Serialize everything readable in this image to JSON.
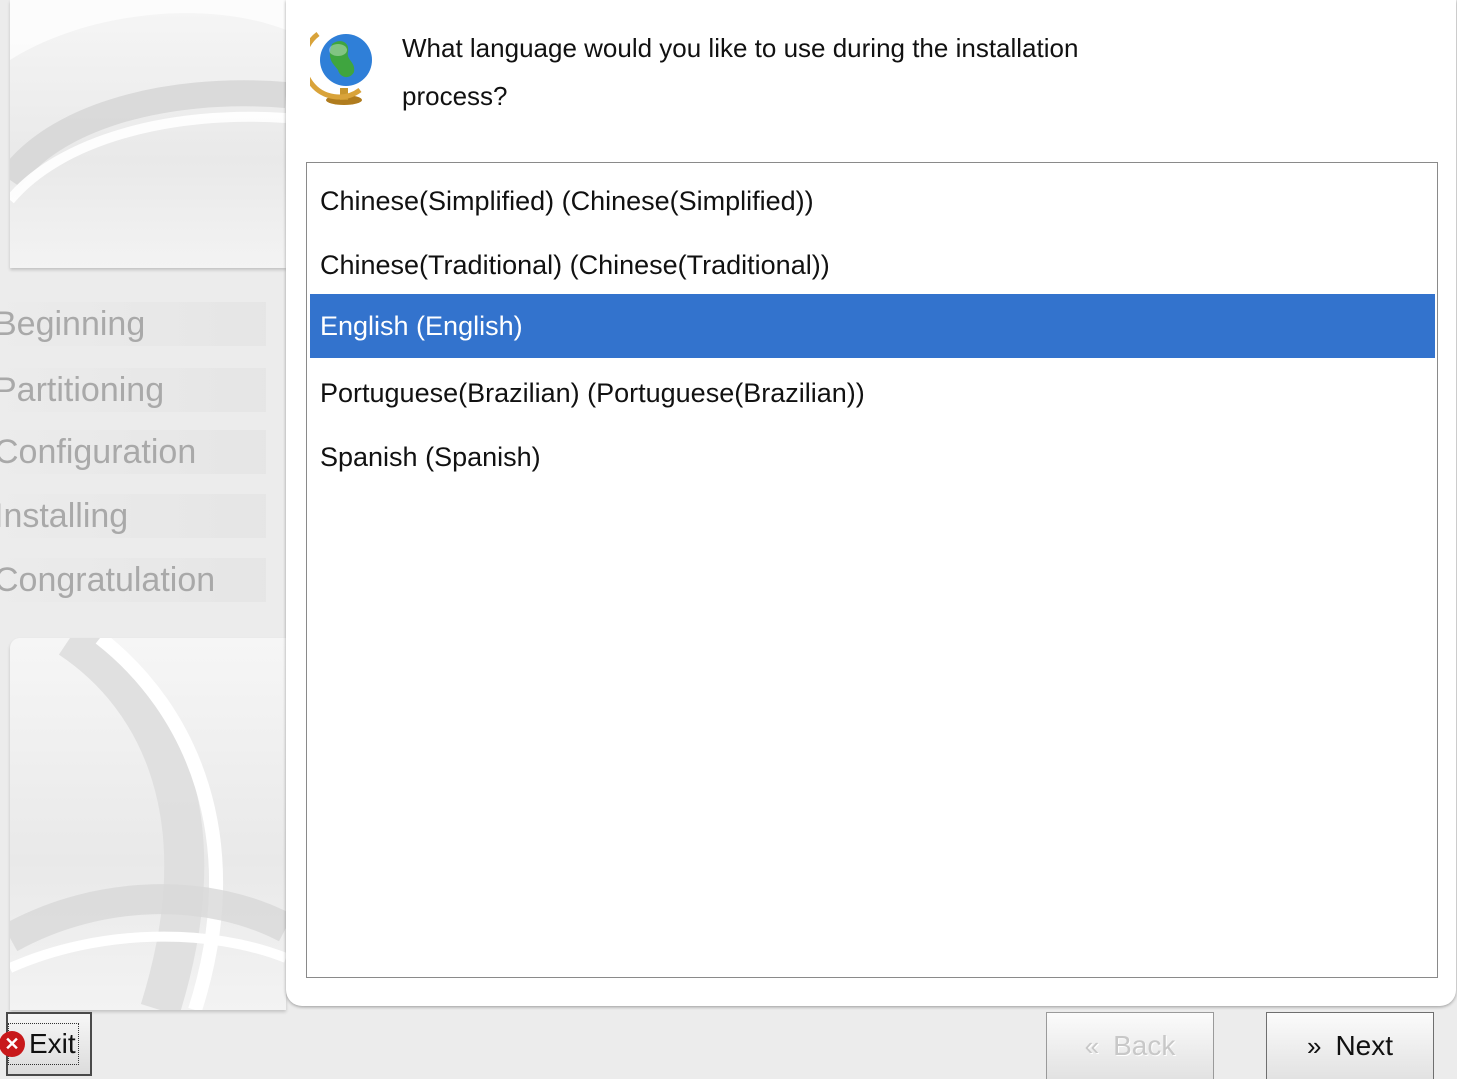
{
  "header": {
    "question": "What language would you like to use during the installation process?",
    "icon": "globe-icon"
  },
  "steps": [
    {
      "label": "Beginning",
      "active": true
    },
    {
      "label": "Partitioning",
      "active": false
    },
    {
      "label": "Configuration",
      "active": false
    },
    {
      "label": "Installing",
      "active": false
    },
    {
      "label": "Congratulation",
      "active": false
    }
  ],
  "languages": [
    {
      "label": "Chinese(Simplified) (Chinese(Simplified))",
      "selected": false
    },
    {
      "label": "Chinese(Traditional) (Chinese(Traditional))",
      "selected": false
    },
    {
      "label": "English (English)",
      "selected": true
    },
    {
      "label": "Portuguese(Brazilian) (Portuguese(Brazilian))",
      "selected": false
    },
    {
      "label": "Spanish (Spanish)",
      "selected": false
    }
  ],
  "buttons": {
    "exit_label": "Exit",
    "back_label": "Back",
    "back_enabled": false,
    "next_label": "Next"
  },
  "colors": {
    "accent": "#3373cd",
    "disabled_text": "#c8c8c8",
    "exit_icon": "#c8191b"
  }
}
